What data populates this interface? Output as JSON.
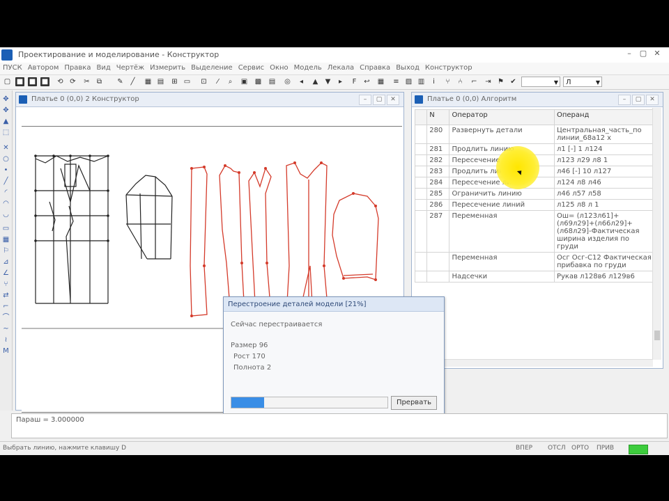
{
  "app": {
    "title": "Проектирование и моделирование - Конструктор",
    "window_buttons": [
      "–",
      "▢",
      "✕"
    ]
  },
  "menu": [
    "ПУСК",
    "Автором",
    "Правка",
    "Вид",
    "Чертёж",
    "Измерить",
    "Выделение",
    "Сервис",
    "Окно",
    "Модель",
    "Лекала",
    "Справка",
    "Выход",
    "Конструктор"
  ],
  "toolbar": {
    "combo1_value": "",
    "combo2_value": "Л"
  },
  "left_window": {
    "title": "Платье 0 (0,0) 2 Конструктор"
  },
  "right_window": {
    "title": "Платье 0 (0,0) Алгоритм",
    "columns": [
      "N",
      "Оператор",
      "Операнд"
    ],
    "rows": [
      {
        "n": "280",
        "op": "Развернуть детали",
        "operand": "Центральная_часть_по линии_68a12 x"
      },
      {
        "n": "281",
        "op": "Продлить линию",
        "operand": "л1 [-] 1 л124"
      },
      {
        "n": "282",
        "op": "Пересечение линий",
        "operand": "л123 л29 л8 1"
      },
      {
        "n": "283",
        "op": "Продлить линию",
        "operand": "л46 [-] 10 л127"
      },
      {
        "n": "284",
        "op": "Пересечение линий",
        "operand": "л124 л8 л46"
      },
      {
        "n": "285",
        "op": "Ограничить линию",
        "operand": "л46 л57 л58"
      },
      {
        "n": "286",
        "op": "Пересечение линий",
        "operand": "л125 л8 л 1"
      },
      {
        "n": "287",
        "op": "Переменная",
        "operand": "Ош= (л123л61]+(л69л29]+(л66л29]+(л68л29]-Фактическая ширина изделия по груди"
      },
      {
        "n": "",
        "op": "Переменная",
        "operand": "Осг Осг-С12 Фактическая прибавка по груди"
      },
      {
        "n": "",
        "op": "Надсечки",
        "operand": "Рукав л128в6 л129в6"
      }
    ]
  },
  "dialog": {
    "title": "Перестроение деталей модели [21%]",
    "status": "Сейчас перестраивается",
    "size_label": "Размер 96",
    "height_label": "Рост 170",
    "fullness_label": "Полнота 2",
    "button": "Прервать",
    "progress": 0.21
  },
  "command_line": {
    "text": "Параш = 3.000000"
  },
  "status_bar": {
    "hint": "Выбрать линию, нажмите клавишу D",
    "mode": "ВПЕР",
    "coords": "ОТСЛ",
    "ortho": "ОРТО",
    "snap": "ПРИВ"
  },
  "colors": {
    "accent": "#1b5fb5",
    "pattern_red": "#d43a2a",
    "construction_black": "#222222",
    "progress": "#3a8ee6",
    "status_green": "#3dcc3d",
    "highlight_yellow": "#ffe600"
  }
}
